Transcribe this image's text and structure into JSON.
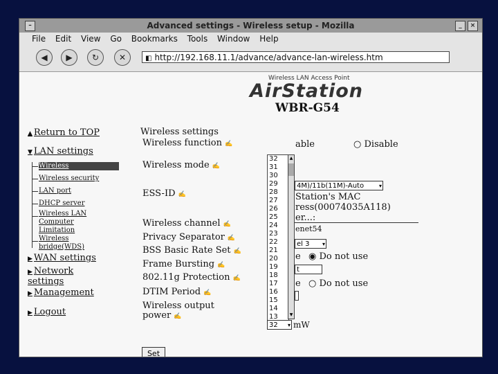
{
  "window": {
    "title": "Advanced settings - Wireless setup - Mozilla"
  },
  "menu": [
    "File",
    "Edit",
    "View",
    "Go",
    "Bookmarks",
    "Tools",
    "Window",
    "Help"
  ],
  "address": {
    "url": "http://192.168.11.1/advance/advance-lan-wireless.htm"
  },
  "brand": {
    "subtitle": "Wireless LAN Access Point",
    "name": "AirStation",
    "model": "WBR-G54"
  },
  "nav": {
    "return_top": "Return to TOP",
    "lan_settings": "LAN settings",
    "lan_items": [
      "Wireless",
      "Wireless security",
      "LAN port",
      "DHCP server",
      "Wireless LAN",
      "Computer",
      "Limitation",
      "Wireless",
      "bridge(WDS)"
    ],
    "wan_settings": "WAN settings",
    "network_1": "Network",
    "network_2": "settings",
    "management": "Management",
    "logout": "Logout"
  },
  "settings": {
    "section_title": "Wireless settings",
    "labels": {
      "wireless_function": "Wireless function",
      "wireless_mode": "Wireless mode",
      "ess_id": "ESS-ID",
      "wireless_channel": "Wireless channel",
      "privacy_separator": "Privacy Separator",
      "bss_basic_rate": "BSS Basic Rate Set",
      "frame_bursting": "Frame Bursting",
      "protection": "802.11g Protection",
      "dtim_period": "DTIM Period",
      "output_power_1": "Wireless output",
      "output_power_2": "power"
    },
    "values": {
      "wireless_function_enable": "able",
      "wireless_function_disable": "Disable",
      "wireless_mode": "4M)/11b(11M)-Auto",
      "essid_line1": "Station's MAC",
      "essid_line2": "ress(00074035A118)",
      "essid_line3": "er...:",
      "essid_value": "enet54",
      "channel": "el 3",
      "privacy_e": "e",
      "privacy_do_not_use": "Do not use",
      "bss_value": "t",
      "frame_e": "e",
      "frame_do_not_use": "Do not use",
      "output_power_selected": "32",
      "output_power_unit": "mW"
    },
    "dropdown_options": [
      "32",
      "31",
      "30",
      "29",
      "28",
      "27",
      "26",
      "25",
      "24",
      "23",
      "22",
      "21",
      "20",
      "19",
      "18",
      "17",
      "16",
      "15",
      "14",
      "13"
    ],
    "set_button": "Set"
  }
}
